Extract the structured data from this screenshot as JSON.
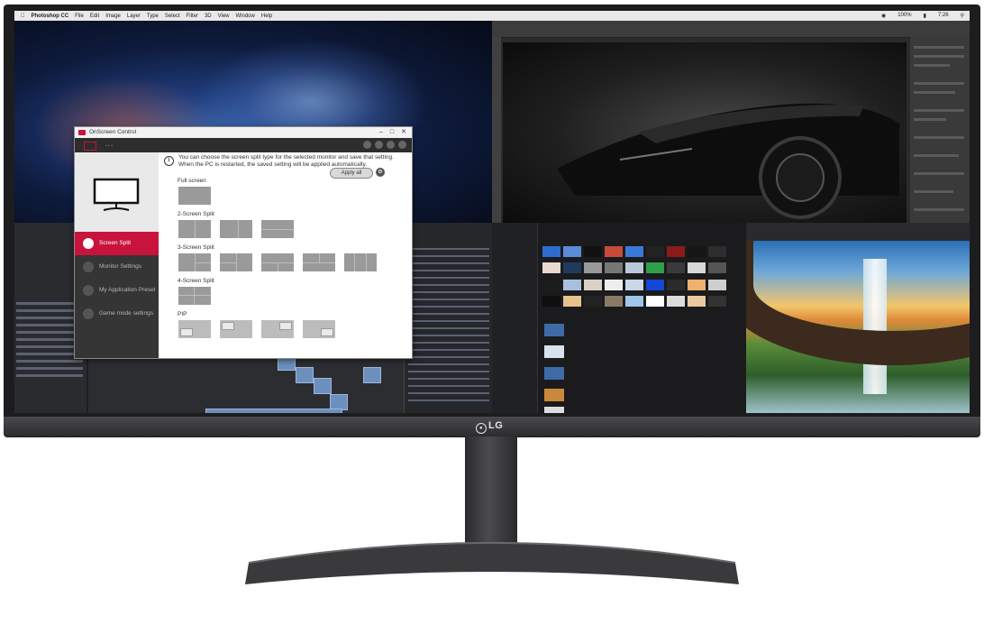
{
  "menubar": {
    "app": "Photoshop CC",
    "items": [
      "File",
      "Edit",
      "Image",
      "Layer",
      "Type",
      "Select",
      "Filter",
      "3D",
      "View",
      "Window",
      "Help"
    ],
    "battery": "100%",
    "time": "7:26"
  },
  "monitor": {
    "brand": "LG",
    "bezel_color": "#1d1d1f",
    "stand_color": "#3a3a3c"
  },
  "osc": {
    "title": "OnScreen Control",
    "window_controls": [
      "–",
      "□",
      "✕"
    ],
    "accent_color": "#c8143c",
    "nav_items": [
      {
        "label": "Screen Split",
        "active": true,
        "icon": "split-icon"
      },
      {
        "label": "Monitor Settings",
        "active": false,
        "icon": "monitor-icon"
      },
      {
        "label": "My Application Preset",
        "active": false,
        "icon": "preset-icon"
      },
      {
        "label": "Game mode settings",
        "active": false,
        "icon": "gamepad-icon"
      }
    ],
    "info_text": "You can choose the screen split type for the selected monitor and save that setting. When the PC is restarted, the saved setting will be applied automatically.",
    "apply_all": "Apply all",
    "info_symbol": "i",
    "sections": {
      "full": "Full screen",
      "two": "2-Screen Split",
      "three": "3-Screen Split",
      "four": "4-Screen Split",
      "pip": "PIP"
    }
  }
}
